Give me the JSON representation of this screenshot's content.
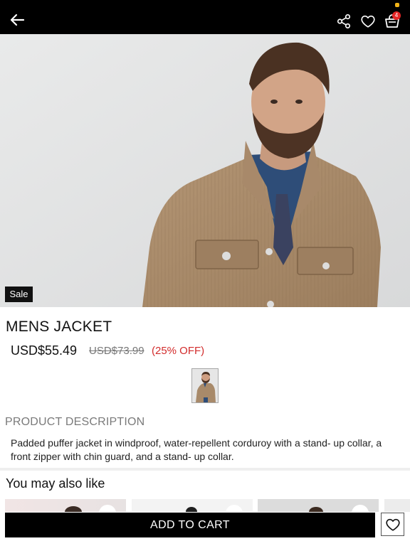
{
  "header": {
    "back_icon": "arrow-left-icon",
    "share_icon": "share-icon",
    "wishlist_icon": "heart-icon",
    "bag_icon": "shopping-bag-icon",
    "bag_count": "4"
  },
  "product": {
    "badge": "Sale",
    "title": "MENS JACKET",
    "price": "USD$55.49",
    "original_price": "USD$73.99",
    "discount": "(25% OFF)",
    "description_heading": "PRODUCT DESCRIPTION",
    "description": "Padded puffer jacket in windproof, water-repellent corduroy with a stand- up collar, a front zipper with chin guard, and a stand- up collar."
  },
  "recommendations": {
    "heading": "You may also like"
  },
  "actions": {
    "add_to_cart": "ADD TO CART",
    "wishlist_icon": "heart-outline-icon"
  },
  "colors": {
    "accent": "#000000",
    "discount": "#d22c2c",
    "badge_count": "#e32626"
  }
}
